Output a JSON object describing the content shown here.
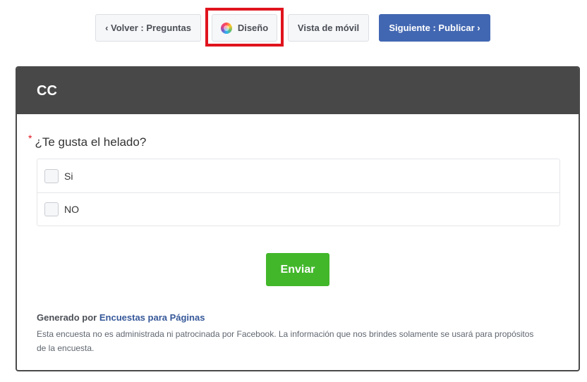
{
  "toolbar": {
    "back_label": "‹ Volver : Preguntas",
    "design_label": "Diseño",
    "mobile_label": "Vista de móvil",
    "next_label": "Siguiente : Publicar ›"
  },
  "survey": {
    "title": "CC",
    "question": {
      "required_mark": "*",
      "text": "¿Te gusta el helado?",
      "options": [
        {
          "label": "Si",
          "checked": false
        },
        {
          "label": "NO",
          "checked": false
        }
      ]
    },
    "submit_label": "Enviar"
  },
  "footer": {
    "generated_prefix": "Generado por",
    "generated_link": "Encuestas para Páginas",
    "disclaimer": "Esta encuesta no es administrada ni patrocinada por Facebook. La información que nos brindes solamente se usará para propósitos de la encuesta."
  },
  "colors": {
    "header_bg": "#484848",
    "primary_button": "#4267b2",
    "submit_button": "#42b72a",
    "highlight": "#e0141e",
    "link": "#365899"
  },
  "icons": {
    "design": "color-wheel-icon"
  }
}
